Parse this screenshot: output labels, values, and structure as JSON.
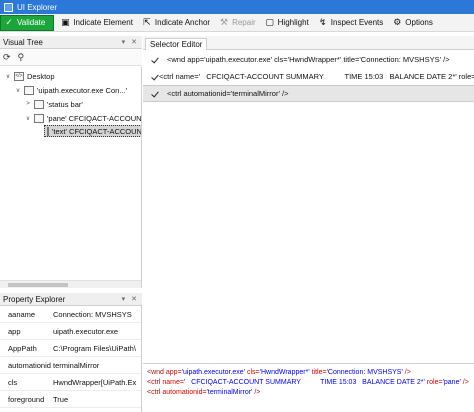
{
  "window": {
    "title": "UI Explorer"
  },
  "toolbar": {
    "validate": "Validate",
    "indicate_element": "Indicate Element",
    "indicate_anchor": "Indicate Anchor",
    "repair": "Repair",
    "highlight": "Highlight",
    "inspect_events": "Inspect Events",
    "options": "Options"
  },
  "visual_tree": {
    "title": "Visual Tree",
    "controls": "▾ ✕",
    "nodes": [
      {
        "label": "Desktop",
        "expander": "∨",
        "icon": "</>"
      },
      {
        "label": "'uipath.executor.exe Con...'",
        "expander": "∨",
        "icon": ""
      },
      {
        "label": "'status bar'",
        "expander": ">",
        "icon": ""
      },
      {
        "label": "'pane' CFCIQACT-ACCOUNT",
        "expander": "∨",
        "icon": ""
      },
      {
        "label": "'text' CFCIQACT-ACCOUN",
        "expander": "",
        "icon": ""
      }
    ]
  },
  "property_explorer": {
    "title": "Property Explorer",
    "controls": "▾ ✕",
    "rows": [
      {
        "key": "aaname",
        "value": "Connection: MVSHSYS"
      },
      {
        "key": "app",
        "value": "uipath.executor.exe"
      },
      {
        "key": "AppPath",
        "value": "C:\\Program Files\\UiPath\\"
      },
      {
        "key": "automationid",
        "value": "terminalMirror"
      },
      {
        "key": "cls",
        "value": "HwndWrapper[UiPath.Ex"
      },
      {
        "key": "foreground",
        "value": "True"
      }
    ]
  },
  "selector_editor": {
    "tab": "Selector Editor",
    "rows": [
      {
        "text": "<wnd app='uipath.executor.exe' cls='HwndWrapper*' title='Connection: MVSHSYS' />",
        "checked": true
      },
      {
        "text": "<ctrl name='   CFCIQACT-ACCOUNT SUMMARY          TIME 15:03   BALANCE DATE 2*' role='pane' />",
        "checked": true
      },
      {
        "text": "<ctrl automationid='terminalMirror' />",
        "checked": true
      }
    ]
  },
  "xml_preview": {
    "lines": [
      [
        {
          "t": "<wnd ",
          "c": "tag"
        },
        {
          "t": "app=",
          "c": "attr"
        },
        {
          "t": "'uipath.executor.exe'",
          "c": "val"
        },
        {
          "t": " cls=",
          "c": "attr"
        },
        {
          "t": "'HwndWrapper*'",
          "c": "val"
        },
        {
          "t": " title=",
          "c": "attr"
        },
        {
          "t": "'Connection: MVSHSYS'",
          "c": "val"
        },
        {
          "t": " />",
          "c": "tag"
        }
      ],
      [
        {
          "t": "<ctrl ",
          "c": "tag"
        },
        {
          "t": "name=",
          "c": "attr"
        },
        {
          "t": "'   CFCIQACT-ACCOUNT SUMMARY          TIME 15:03   BALANCE DATE 2*'",
          "c": "val"
        },
        {
          "t": " role=",
          "c": "attr"
        },
        {
          "t": "'pane'",
          "c": "val"
        },
        {
          "t": " />",
          "c": "tag"
        }
      ],
      [
        {
          "t": "<ctrl ",
          "c": "tag"
        },
        {
          "t": "automationid=",
          "c": "attr"
        },
        {
          "t": "'terminalMirror'",
          "c": "val"
        },
        {
          "t": " />",
          "c": "tag"
        }
      ]
    ]
  },
  "colors": {
    "titlebar": "#2b78d8",
    "validate_button": "#1aa63a",
    "xml_tag": "#a31515",
    "xml_attr": "#e00000",
    "xml_value": "#0000ff"
  }
}
